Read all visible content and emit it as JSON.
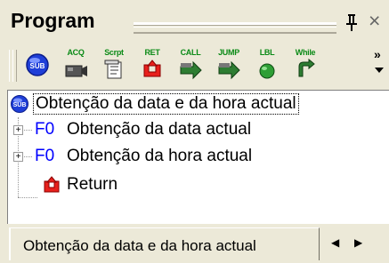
{
  "window": {
    "title": "Program",
    "pin_glyph": "↕",
    "close_glyph": "×"
  },
  "toolbar": {
    "items": [
      {
        "label": "",
        "icon": "sub-icon"
      },
      {
        "label": "ACQ",
        "icon": "camera-icon"
      },
      {
        "label": "Scrpt",
        "icon": "script-icon"
      },
      {
        "label": "RET",
        "icon": "return-icon"
      },
      {
        "label": "CALL",
        "icon": "call-arrow-icon"
      },
      {
        "label": "JUMP",
        "icon": "jump-arrow-icon"
      },
      {
        "label": "LBL",
        "icon": "label-ball-icon"
      },
      {
        "label": "While",
        "icon": "loop-icon"
      }
    ],
    "more_glyph": "»"
  },
  "tree": {
    "root": {
      "text": "Obtenção da data e da hora actual",
      "icon": "sub-icon"
    },
    "children": [
      {
        "prefix": "F0",
        "text": "Obtenção da data actual"
      },
      {
        "prefix": "F0",
        "text": "Obtenção da hora actual"
      },
      {
        "prefix": "",
        "text": "Return",
        "icon": "return-icon"
      }
    ]
  },
  "tabs": {
    "active": "Obtenção da data e da hora actual",
    "prev_glyph": "◀",
    "next_glyph": "▶"
  }
}
